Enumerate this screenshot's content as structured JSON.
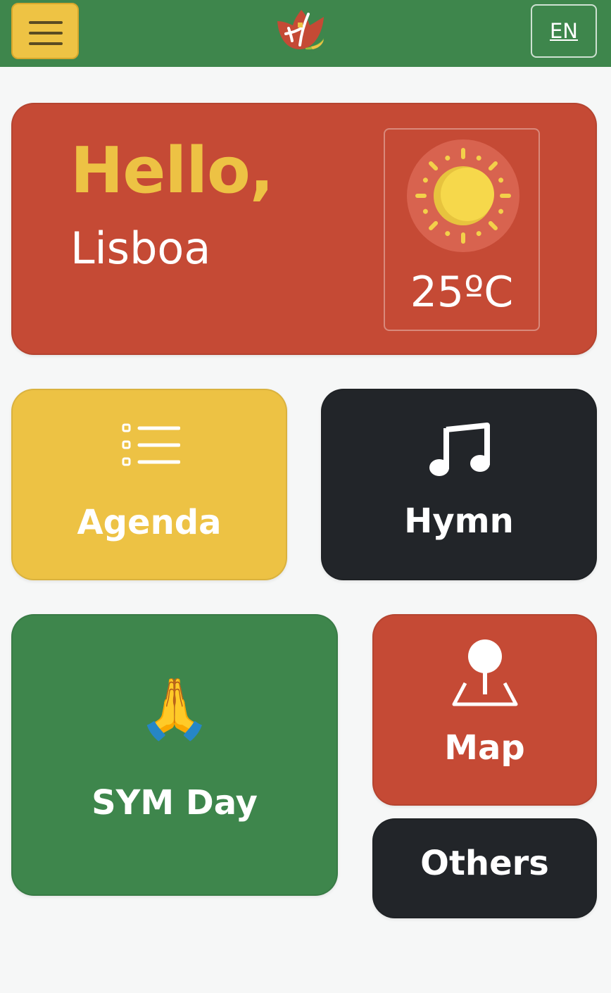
{
  "header": {
    "menu_icon": "hamburger-menu-icon",
    "logo_icon": "tulip-logo-icon",
    "language_label": "EN"
  },
  "greeting": {
    "hello": "Hello,",
    "city": "Lisboa"
  },
  "weather": {
    "icon": "sun-icon",
    "temperature": "25ºC"
  },
  "tiles": {
    "agenda": {
      "label": "Agenda",
      "icon": "list-icon"
    },
    "hymn": {
      "label": "Hymn",
      "icon": "music-note-icon"
    },
    "sym_day": {
      "label": "SYM Day",
      "icon": "🙏"
    },
    "map": {
      "label": "Map",
      "icon": "map-pin-icon"
    },
    "others": {
      "label": "Others"
    }
  },
  "colors": {
    "green": "#3e864c",
    "red": "#c54a35",
    "yellow": "#edc244",
    "dark": "#222529",
    "background": "#f6f7f7"
  }
}
